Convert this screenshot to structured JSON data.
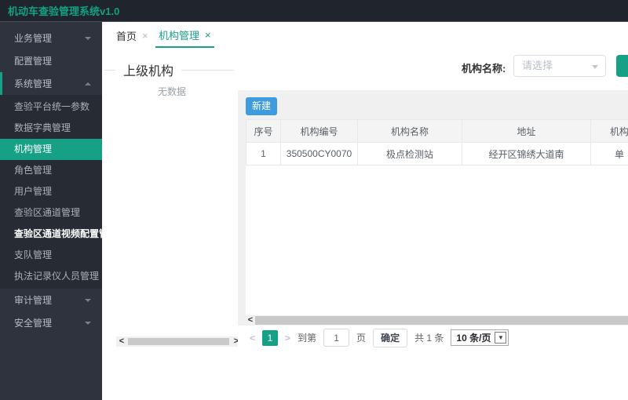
{
  "app": {
    "title": "机动车查验管理系统v1.0"
  },
  "colors": {
    "theme": "#16a085",
    "new_button_blue": "#3e9bdd",
    "sidebar_bg": "#2e333e",
    "header_bg": "#20242c"
  },
  "sidebar": {
    "groups": [
      {
        "label": "业务管理",
        "caret": "down"
      },
      {
        "label": "配置管理",
        "caret": "none"
      },
      {
        "label": "系统管理",
        "caret": "up"
      },
      {
        "label": "审计管理",
        "caret": "down"
      },
      {
        "label": "安全管理",
        "caret": "down"
      }
    ],
    "system_submenu": [
      "查验平台统一参数",
      "数据字典管理",
      "机构管理",
      "角色管理",
      "用户管理",
      "查验区通道管理",
      "查验区通道视频配置管理",
      "支队管理",
      "执法记录仪人员管理"
    ],
    "active_item": "机构管理"
  },
  "tabs": [
    {
      "label": "首页",
      "close": "×"
    },
    {
      "label": "机构管理",
      "close": "×"
    }
  ],
  "active_tab": "机构管理",
  "toolbar": {
    "org_label": "机构名称:",
    "select_placeholder": "请选择"
  },
  "tree_panel": {
    "legend": "上级机构",
    "empty": "无数据"
  },
  "table_panel": {
    "new_button": "新建",
    "columns": [
      "序号",
      "机构编号",
      "机构名称",
      "地址",
      "机构"
    ],
    "rows": [
      {
        "cells": [
          "1",
          "350500CY0070",
          "极点检测站",
          "经开区锦绣大道南",
          "单"
        ]
      }
    ]
  },
  "pagination": {
    "prev": "<",
    "current_page": "1",
    "next": ">",
    "goto_label": "到第",
    "goto_value": "1",
    "page_unit": "页",
    "confirm": "确定",
    "total": "共 1 条",
    "page_size": "10 条/页",
    "size_caret": "▼"
  },
  "scrollbars": {
    "left_arrow": "<",
    "right_arrow": ">"
  }
}
